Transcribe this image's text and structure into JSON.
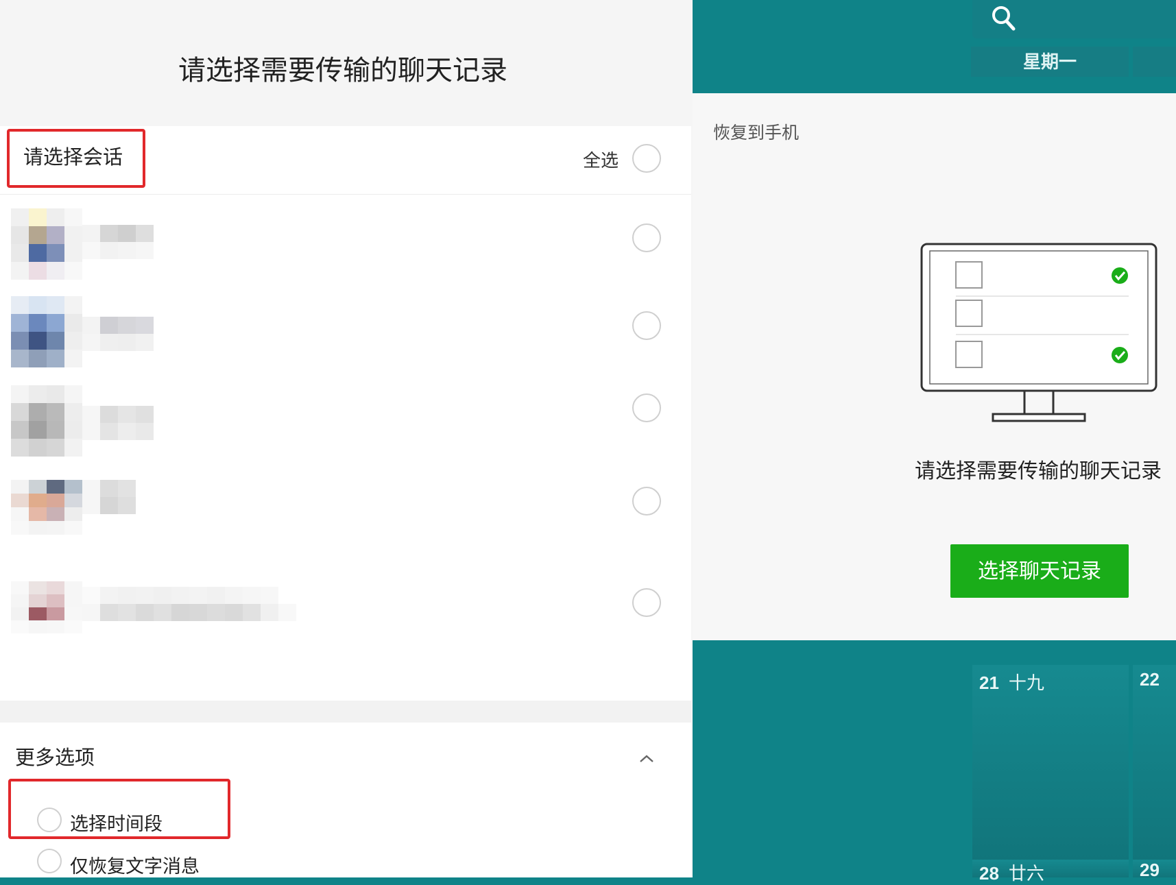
{
  "left": {
    "title": "请选择需要传输的聊天记录",
    "session_title": "请选择会话",
    "select_all": "全选",
    "more": {
      "title": "更多选项",
      "option_time": "选择时间段",
      "option_text_only": "仅恢复文字消息"
    }
  },
  "right": {
    "weekday": "星期一",
    "restore_label": "恢复到手机",
    "prompt": "请选择需要传输的聊天记录",
    "choose_button": "选择聊天记录",
    "calendar": [
      {
        "day": "21",
        "lunar": "十九"
      },
      {
        "day": "22",
        "lunar": ""
      },
      {
        "day": "28",
        "lunar": "廿六"
      },
      {
        "day": "29",
        "lunar": ""
      }
    ]
  },
  "icons": {
    "search": "search-icon",
    "chevron": "chevron-up-icon",
    "check": "check-circle-icon"
  },
  "colors": {
    "accent_green": "#1aad19",
    "highlight_red": "#e1282b",
    "calendar_teal": "#0f8388"
  }
}
